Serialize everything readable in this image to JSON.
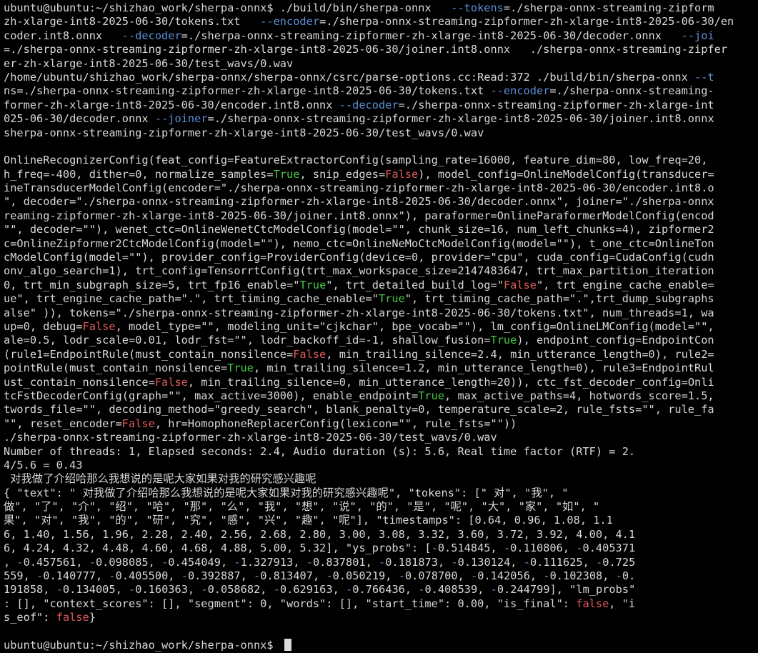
{
  "colors": {
    "background": "#000000",
    "text": "#d9d9d9",
    "option": "#5c8fd6",
    "bool_true": "#46c846",
    "bool_false": "#e05a5a"
  },
  "lines": [
    [
      [
        "t",
        "ubuntu@ubuntu:~/shizhao_work/sherpa-onnx$ ./build/bin/sherpa-onnx   "
      ],
      [
        "o",
        "--tokens"
      ],
      [
        "t",
        "=./sherpa-onnx-streaming-zipform"
      ]
    ],
    [
      [
        "t",
        "zh-xlarge-int8-2025-06-30/tokens.txt   "
      ],
      [
        "o",
        "--encoder"
      ],
      [
        "t",
        "=./sherpa-onnx-streaming-zipformer-zh-xlarge-int8-2025-06-30/en"
      ]
    ],
    [
      [
        "t",
        "coder.int8.onnx   "
      ],
      [
        "o",
        "--decoder"
      ],
      [
        "t",
        "=./sherpa-onnx-streaming-zipformer-zh-xlarge-int8-2025-06-30/decoder.onnx   "
      ],
      [
        "o",
        "--joi"
      ]
    ],
    [
      [
        "t",
        "=./sherpa-onnx-streaming-zipformer-zh-xlarge-int8-2025-06-30/joiner.int8.onnx   ./sherpa-onnx-streaming-zipfer"
      ]
    ],
    [
      [
        "t",
        "er-zh-xlarge-int8-2025-06-30/test_wavs/0.wav"
      ]
    ],
    [
      [
        "t",
        "/home/ubuntu/shizhao_work/sherpa-onnx/sherpa-onnx/csrc/parse-options.cc:Read:372 ./build/bin/sherpa-onnx "
      ],
      [
        "o",
        "--t"
      ]
    ],
    [
      [
        "t",
        "ns=./sherpa-onnx-streaming-zipformer-zh-xlarge-int8-2025-06-30/tokens.txt "
      ],
      [
        "o",
        "--encoder"
      ],
      [
        "t",
        "=./sherpa-onnx-streaming-"
      ]
    ],
    [
      [
        "t",
        "former-zh-xlarge-int8-2025-06-30/encoder.int8.onnx "
      ],
      [
        "o",
        "--decoder"
      ],
      [
        "t",
        "=./sherpa-onnx-streaming-zipformer-zh-xlarge-int"
      ]
    ],
    [
      [
        "t",
        "025-06-30/decoder.onnx "
      ],
      [
        "o",
        "--joiner"
      ],
      [
        "t",
        "=./sherpa-onnx-streaming-zipformer-zh-xlarge-int8-2025-06-30/joiner.int8.onnx"
      ]
    ],
    [
      [
        "t",
        "sherpa-onnx-streaming-zipformer-zh-xlarge-int8-2025-06-30/test_wavs/0.wav"
      ]
    ],
    [
      [
        "t",
        ""
      ]
    ],
    [
      [
        "t",
        "OnlineRecognizerConfig(feat_config=FeatureExtractorConfig(sampling_rate=16000, feature_dim=80, low_freq=20,"
      ]
    ],
    [
      [
        "t",
        "h_freq=-400, dither=0, normalize_samples="
      ],
      [
        "g",
        "True"
      ],
      [
        "t",
        ", snip_edges="
      ],
      [
        "r",
        "False"
      ],
      [
        "t",
        "), model_config=OnlineModelConfig(transducer="
      ]
    ],
    [
      [
        "t",
        "ineTransducerModelConfig(encoder=\"./sherpa-onnx-streaming-zipformer-zh-xlarge-int8-2025-06-30/encoder.int8.o"
      ]
    ],
    [
      [
        "t",
        "\", decoder=\"./sherpa-onnx-streaming-zipformer-zh-xlarge-int8-2025-06-30/decoder.onnx\", joiner=\"./sherpa-onnx"
      ]
    ],
    [
      [
        "t",
        "reaming-zipformer-zh-xlarge-int8-2025-06-30/joiner.int8.onnx\"), paraformer=OnlineParaformerModelConfig(encod"
      ]
    ],
    [
      [
        "t",
        "\"\", decoder=\"\"), wenet_ctc=OnlineWenetCtcModelConfig(model=\"\", chunk_size=16, num_left_chunks=4), zipformer2"
      ]
    ],
    [
      [
        "t",
        "c=OnlineZipformer2CtcModelConfig(model=\"\"), nemo_ctc=OnlineNeMoCtcModelConfig(model=\"\"), t_one_ctc=OnlineTon"
      ]
    ],
    [
      [
        "t",
        "cModelConfig(model=\"\"), provider_config=ProviderConfig(device=0, provider=\"cpu\", cuda_config=CudaConfig(cudn"
      ]
    ],
    [
      [
        "t",
        "onv_algo_search=1), trt_config=TensorrtConfig(trt_max_workspace_size=2147483647, trt_max_partition_iteration"
      ]
    ],
    [
      [
        "t",
        "0, trt_min_subgraph_size=5, trt_fp16_enable=\""
      ],
      [
        "g",
        "True"
      ],
      [
        "t",
        "\", trt_detailed_build_log=\""
      ],
      [
        "r",
        "False"
      ],
      [
        "t",
        "\", trt_engine_cache_enable="
      ]
    ],
    [
      [
        "t",
        "ue\", trt_engine_cache_path=\".\", trt_timing_cache_enable=\""
      ],
      [
        "g",
        "True"
      ],
      [
        "t",
        "\", trt_timing_cache_path=\".\",trt_dump_subgraphs"
      ]
    ],
    [
      [
        "t",
        "alse\" )), tokens=\"./sherpa-onnx-streaming-zipformer-zh-xlarge-int8-2025-06-30/tokens.txt\", num_threads=1, wa"
      ]
    ],
    [
      [
        "t",
        "up=0, debug="
      ],
      [
        "r",
        "False"
      ],
      [
        "t",
        ", model_type=\"\", modeling_unit=\"cjkchar\", bpe_vocab=\"\"), lm_config=OnlineLMConfig(model=\"\","
      ]
    ],
    [
      [
        "t",
        "ale=0.5, lodr_scale=0.01, lodr_fst=\"\", lodr_backoff_id=-1, shallow_fusion="
      ],
      [
        "g",
        "True"
      ],
      [
        "t",
        "), endpoint_config=EndpointCon"
      ]
    ],
    [
      [
        "t",
        "(rule1=EndpointRule(must_contain_nonsilence="
      ],
      [
        "r",
        "False"
      ],
      [
        "t",
        ", min_trailing_silence=2.4, min_utterance_length=0), rule2="
      ]
    ],
    [
      [
        "t",
        "pointRule(must_contain_nonsilence="
      ],
      [
        "g",
        "True"
      ],
      [
        "t",
        ", min_trailing_silence=1.2, min_utterance_length=0), rule3=EndpointRul"
      ]
    ],
    [
      [
        "t",
        "ust_contain_nonsilence="
      ],
      [
        "r",
        "False"
      ],
      [
        "t",
        ", min_trailing_silence=0, min_utterance_length=20)), ctc_fst_decoder_config=Onli"
      ]
    ],
    [
      [
        "t",
        "tcFstDecoderConfig(graph=\"\", max_active=3000), enable_endpoint="
      ],
      [
        "g",
        "True"
      ],
      [
        "t",
        ", max_active_paths=4, hotwords_score=1.5,"
      ]
    ],
    [
      [
        "t",
        "twords_file=\"\", decoding_method=\"greedy_search\", blank_penalty=0, temperature_scale=2, rule_fsts=\"\", rule_fa"
      ]
    ],
    [
      [
        "t",
        "\"\", reset_encoder="
      ],
      [
        "r",
        "False"
      ],
      [
        "t",
        ", hr=HomophoneReplacerConfig(lexicon=\"\", rule_fsts=\"\"))"
      ]
    ],
    [
      [
        "t",
        "./sherpa-onnx-streaming-zipformer-zh-xlarge-int8-2025-06-30/test_wavs/0.wav"
      ]
    ],
    [
      [
        "t",
        "Number of threads: 1, Elapsed seconds: 2.4, Audio duration (s): 5.6, Real time factor (RTF) = 2."
      ]
    ],
    [
      [
        "t",
        "4/5.6 = 0.43"
      ]
    ],
    [
      [
        "t",
        " 对我做了介绍哈那么我想说的是呢大家如果对我的研究感兴趣呢"
      ]
    ],
    [
      [
        "t",
        "{ \"text\": \" 对我做了介绍哈那么我想说的是呢大家如果对我的研究感兴趣呢\", \"tokens\": [\" 对\", \"我\", \""
      ]
    ],
    [
      [
        "t",
        "做\", \"了\", \"介\", \"绍\", \"哈\", \"那\", \"么\", \"我\", \"想\", \"说\", \"的\", \"是\", \"呢\", \"大\", \"家\", \"如\", \""
      ]
    ],
    [
      [
        "t",
        "果\", \"对\", \"我\", \"的\", \"研\", \"究\", \"感\", \"兴\", \"趣\", \"呢\"], \"timestamps\": [0.64, 0.96, 1.08, 1.1"
      ]
    ],
    [
      [
        "t",
        "6, 1.40, 1.56, 1.96, 2.28, 2.40, 2.56, 2.68, 2.80, 3.00, 3.08, 3.32, 3.60, 3.72, 3.92, 4.00, 4.1"
      ]
    ],
    [
      [
        "t",
        "6, 4.24, 4.32, 4.48, 4.60, 4.68, 4.88, 5.00, 5.32], \"ys_probs\": ["
      ],
      [
        "o",
        "-"
      ],
      [
        "t",
        "0.514845, "
      ],
      [
        "o",
        "-"
      ],
      [
        "t",
        "0.110806, "
      ],
      [
        "o",
        "-"
      ],
      [
        "t",
        "0.405371"
      ]
    ],
    [
      [
        "t",
        ", "
      ],
      [
        "o",
        "-"
      ],
      [
        "t",
        "0.457561, "
      ],
      [
        "o",
        "-"
      ],
      [
        "t",
        "0.098085, "
      ],
      [
        "o",
        "-"
      ],
      [
        "t",
        "0.454049, "
      ],
      [
        "o",
        "-"
      ],
      [
        "t",
        "1.327913, "
      ],
      [
        "o",
        "-"
      ],
      [
        "t",
        "0.837801, "
      ],
      [
        "o",
        "-"
      ],
      [
        "t",
        "0.181873, "
      ],
      [
        "o",
        "-"
      ],
      [
        "t",
        "0.130124, "
      ],
      [
        "o",
        "-"
      ],
      [
        "t",
        "0.111625, "
      ],
      [
        "o",
        "-"
      ],
      [
        "t",
        "0.725"
      ]
    ],
    [
      [
        "t",
        "559, "
      ],
      [
        "o",
        "-"
      ],
      [
        "t",
        "0.140777, "
      ],
      [
        "o",
        "-"
      ],
      [
        "t",
        "0.405500, "
      ],
      [
        "o",
        "-"
      ],
      [
        "t",
        "0.392887, "
      ],
      [
        "o",
        "-"
      ],
      [
        "t",
        "0.813407, "
      ],
      [
        "o",
        "-"
      ],
      [
        "t",
        "0.050219, "
      ],
      [
        "o",
        "-"
      ],
      [
        "t",
        "0.078700, "
      ],
      [
        "o",
        "-"
      ],
      [
        "t",
        "0.142056, "
      ],
      [
        "o",
        "-"
      ],
      [
        "t",
        "0.102308, "
      ],
      [
        "o",
        "-"
      ],
      [
        "t",
        "0."
      ]
    ],
    [
      [
        "t",
        "191858, "
      ],
      [
        "o",
        "-"
      ],
      [
        "t",
        "0.134005, "
      ],
      [
        "o",
        "-"
      ],
      [
        "t",
        "0.160363, "
      ],
      [
        "o",
        "-"
      ],
      [
        "t",
        "0.058682, "
      ],
      [
        "o",
        "-"
      ],
      [
        "t",
        "0.629163, "
      ],
      [
        "o",
        "-"
      ],
      [
        "t",
        "0.766436, "
      ],
      [
        "o",
        "-"
      ],
      [
        "t",
        "0.408539, "
      ],
      [
        "o",
        "-"
      ],
      [
        "t",
        "0.244799], \"lm_probs\""
      ]
    ],
    [
      [
        "t",
        ": [], \"context_scores\": [], \"segment\": 0, \"words\": [], \"start_time\": 0.00, \"is_final\": "
      ],
      [
        "r",
        "false"
      ],
      [
        "t",
        ", \"i"
      ]
    ],
    [
      [
        "t",
        "s_eof\": "
      ],
      [
        "r",
        "false"
      ],
      [
        "t",
        "}"
      ]
    ],
    [
      [
        "t",
        ""
      ]
    ],
    [
      [
        "t",
        "ubuntu@ubuntu:~/shizhao_work/sherpa-onnx$ "
      ]
    ]
  ]
}
